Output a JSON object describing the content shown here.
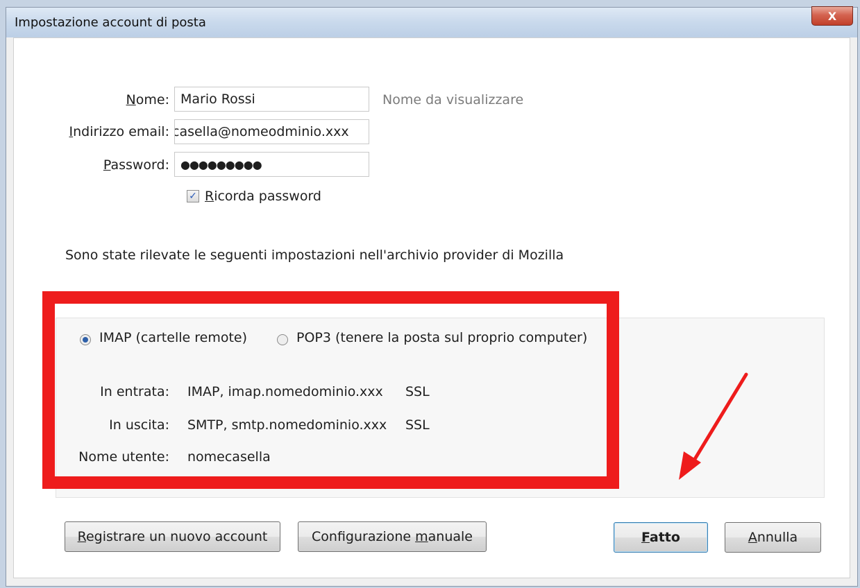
{
  "window": {
    "title": "Impostazione account di posta",
    "close_glyph": "X"
  },
  "form": {
    "name_label_prefix": "N",
    "name_label_rest": "ome:",
    "name_value": "Mario Rossi",
    "name_hint": "Nome da visualizzare",
    "email_label_prefix": "I",
    "email_label_rest": "ndirizzo email:",
    "email_value": "casella@nomeodminio.xxx",
    "password_label_prefix": "P",
    "password_label_rest": "assword:",
    "password_value": "●●●●●●●●●",
    "remember_checked": true,
    "remember_label_prefix": "R",
    "remember_label_rest": "icorda password"
  },
  "detected_message": "Sono state rilevate le seguenti impostazioni nell'archivio provider di Mozilla",
  "protocol": {
    "imap_label": "IMAP (cartelle remote)",
    "pop3_label": "POP3 (tenere la posta sul proprio computer)",
    "selected": "IMAP"
  },
  "server_settings": {
    "incoming_label": "In entrata:",
    "incoming_value": "IMAP, imap.nomedominio.xxx",
    "incoming_security": "SSL",
    "outgoing_label": "In uscita:",
    "outgoing_value": "SMTP, smtp.nomedominio.xxx",
    "outgoing_security": "SSL",
    "username_label": "Nome utente:",
    "username_value": "nomecasella"
  },
  "buttons": {
    "register_prefix": "R",
    "register_rest": "egistrare un nuovo account",
    "manual_prefix": "Configurazione ",
    "manual_underlined": "m",
    "manual_rest": "anuale",
    "done_prefix": "F",
    "done_rest": "atto",
    "cancel_prefix": "A",
    "cancel_rest": "nnulla"
  },
  "colors": {
    "annotation_red": "#ee1c1c",
    "checkbox_check": "#2a5ab8"
  },
  "icons": {
    "close": "close-icon",
    "checkbox": "checkmark-icon",
    "radio_selected": "radio-selected-icon",
    "annotation_arrow": "arrow-icon"
  }
}
